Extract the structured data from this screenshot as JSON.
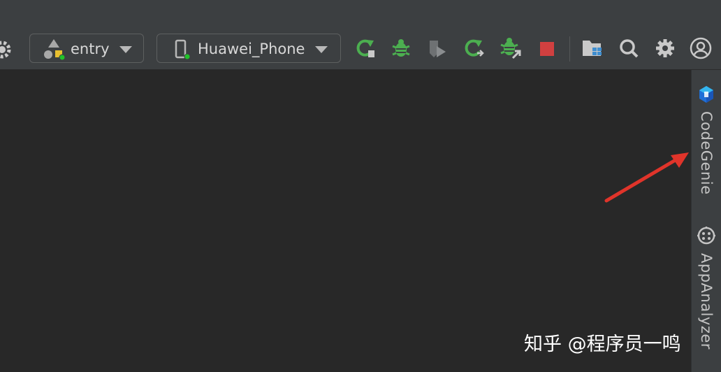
{
  "toolbar": {
    "config_selector": {
      "label": "entry",
      "icon": "module-config-icon"
    },
    "device_selector": {
      "label": "Huawei_Phone",
      "icon": "phone-device-icon"
    },
    "buttons": [
      {
        "name": "run-icon",
        "color": "#4caf50"
      },
      {
        "name": "debug-icon",
        "color": "#4caf50"
      },
      {
        "name": "profile-icon",
        "color": "#6e7173"
      },
      {
        "name": "rerun-icon",
        "color": "#4caf50"
      },
      {
        "name": "attach-debugger-icon",
        "color": "#4caf50"
      },
      {
        "name": "stop-icon",
        "color": "#d04040"
      },
      {
        "name": "project-structure-icon",
        "color": "#c9c9c9"
      },
      {
        "name": "search-icon",
        "color": "#c9c9c9"
      },
      {
        "name": "settings-icon",
        "color": "#c9c9c9"
      },
      {
        "name": "account-icon",
        "color": "#c9c9c9"
      }
    ]
  },
  "right_sidebar": {
    "tabs": [
      {
        "label": "CodeGenie",
        "icon": "codegenie-icon"
      },
      {
        "label": "AppAnalyzer",
        "icon": "appanalyzer-icon"
      }
    ]
  },
  "annotation": {
    "type": "arrow",
    "color": "#e0342a",
    "target": "CodeGenie tab"
  },
  "watermark": {
    "text": "知乎 @程序员一鸣"
  }
}
